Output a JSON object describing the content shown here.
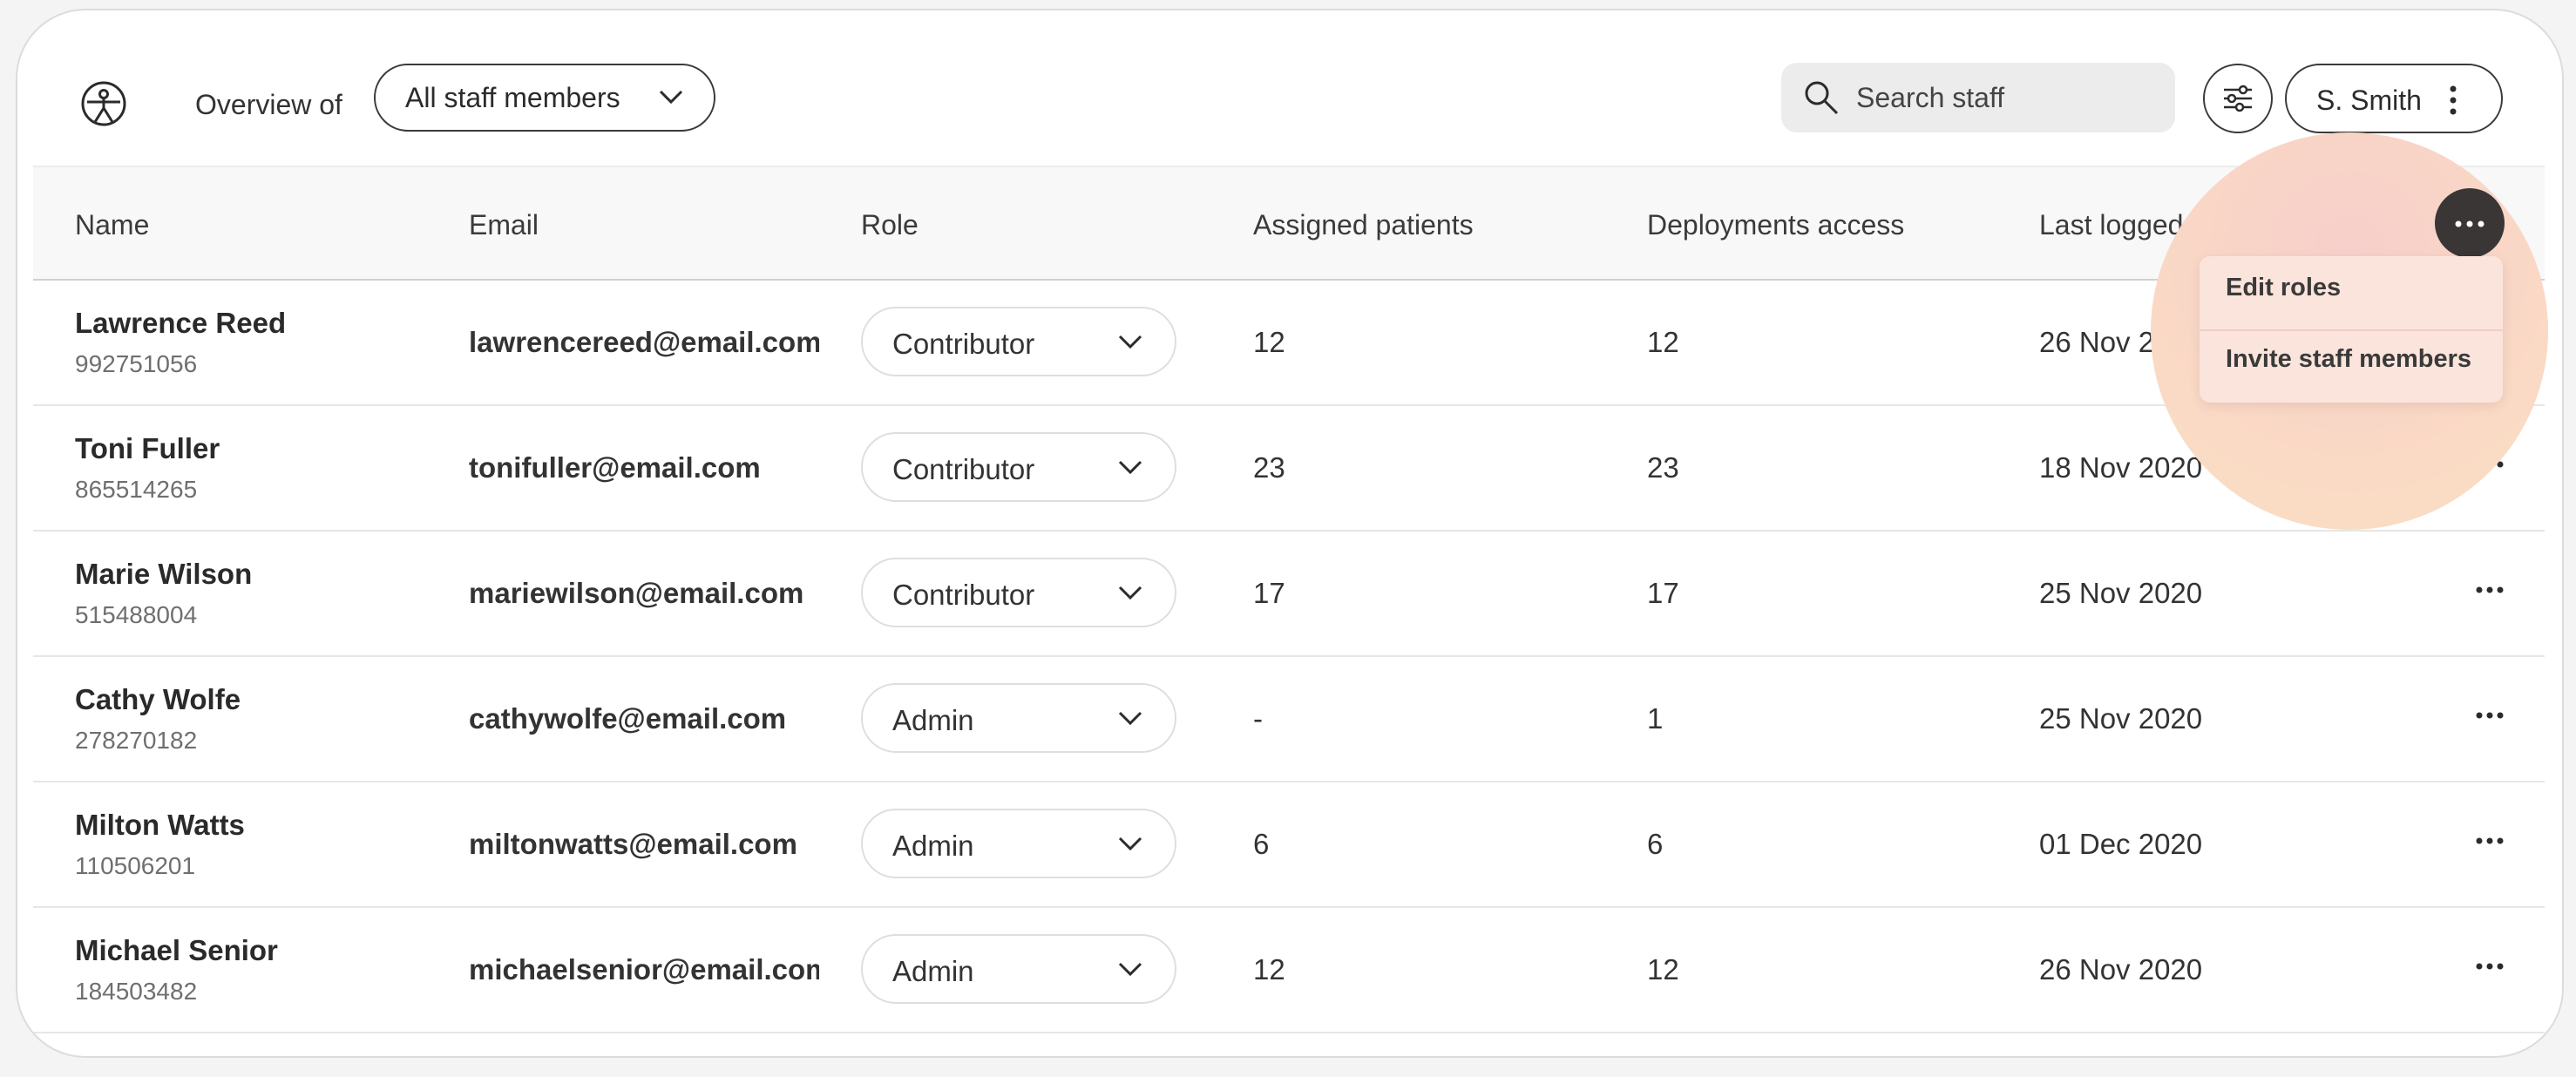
{
  "header": {
    "overview_label": "Overview of",
    "staff_filter_value": "All staff members",
    "search_placeholder": "Search staff",
    "user_name": "S. Smith"
  },
  "table": {
    "columns": [
      "Name",
      "Email",
      "Role",
      "Assigned patients",
      "Deployments access",
      "Last logged in"
    ],
    "rows": [
      {
        "name": "Lawrence Reed",
        "id": "992751056",
        "email": "lawrencereed@email.com",
        "role": "Contributor",
        "assigned": "12",
        "deployments": "12",
        "last_login": "26 Nov 2020"
      },
      {
        "name": "Toni Fuller",
        "id": "865514265",
        "email": "tonifuller@email.com",
        "role": "Contributor",
        "assigned": "23",
        "deployments": "23",
        "last_login": "18 Nov 2020"
      },
      {
        "name": "Marie Wilson",
        "id": "515488004",
        "email": "mariewilson@email.com",
        "role": "Contributor",
        "assigned": "17",
        "deployments": "17",
        "last_login": "25 Nov 2020"
      },
      {
        "name": "Cathy Wolfe",
        "id": "278270182",
        "email": "cathywolfe@email.com",
        "role": "Admin",
        "assigned": "-",
        "deployments": "1",
        "last_login": "25 Nov 2020"
      },
      {
        "name": "Milton Watts",
        "id": "110506201",
        "email": "miltonwatts@email.com",
        "role": "Admin",
        "assigned": "6",
        "deployments": "6",
        "last_login": "01 Dec 2020"
      },
      {
        "name": "Michael Senior",
        "id": "184503482",
        "email": "michaelsenior@email.com",
        "role": "Admin",
        "assigned": "12",
        "deployments": "12",
        "last_login": "26 Nov 2020"
      }
    ]
  },
  "menu": {
    "items": [
      "Edit roles",
      "Invite staff members"
    ]
  },
  "colors": {
    "accent_dark": "#3a3636",
    "halo": "#f9d6c6",
    "search_bg": "#ececec"
  },
  "icons": [
    "logo-icon",
    "chevron-down-icon",
    "search-icon",
    "filter-icon",
    "kebab-vertical-icon",
    "more-horizontal-icon"
  ]
}
